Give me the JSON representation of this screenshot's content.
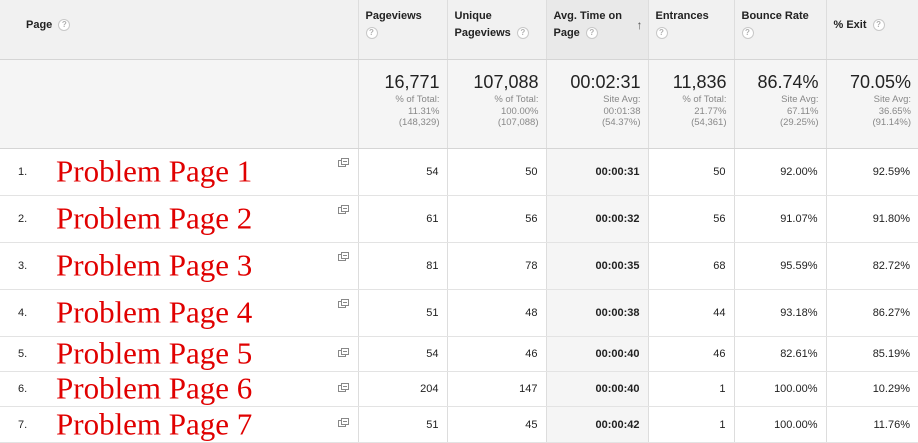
{
  "columns": {
    "page": "Page",
    "pageviews": "Pageviews",
    "unique_line1": "Unique",
    "unique_line2": "Pageviews",
    "avgtime_line1": "Avg. Time on",
    "avgtime_line2": "Page",
    "entrances": "Entrances",
    "bounce": "Bounce Rate",
    "exit": "% Exit",
    "help_glyph": "?",
    "sort_glyph": "↑"
  },
  "summary": {
    "pageviews": {
      "value": "16,771",
      "line1": "% of Total:",
      "line2": "11.31%",
      "line3": "(148,329)"
    },
    "unique": {
      "value": "107,088",
      "line1": "% of Total:",
      "line2": "100.00%",
      "line3": "(107,088)"
    },
    "avgtime": {
      "value": "00:02:31",
      "line1": "Site Avg:",
      "line2": "00:01:38",
      "line3": "(54.37%)"
    },
    "entrances": {
      "value": "11,836",
      "line1": "% of Total:",
      "line2": "21.77%",
      "line3": "(54,361)"
    },
    "bounce": {
      "value": "86.74%",
      "line1": "Site Avg:",
      "line2": "67.11%",
      "line3": "(29.25%)"
    },
    "exit": {
      "value": "70.05%",
      "line1": "Site Avg:",
      "line2": "36.65%",
      "line3": "(91.14%)"
    }
  },
  "rows": [
    {
      "index": "1.",
      "page": "Problem Page 1",
      "pageviews": "54",
      "unique": "50",
      "avgtime": "00:00:31",
      "entrances": "50",
      "bounce": "92.00%",
      "exit": "92.59%"
    },
    {
      "index": "2.",
      "page": "Problem Page 2",
      "pageviews": "61",
      "unique": "56",
      "avgtime": "00:00:32",
      "entrances": "56",
      "bounce": "91.07%",
      "exit": "91.80%"
    },
    {
      "index": "3.",
      "page": "Problem Page 3",
      "pageviews": "81",
      "unique": "78",
      "avgtime": "00:00:35",
      "entrances": "68",
      "bounce": "95.59%",
      "exit": "82.72%"
    },
    {
      "index": "4.",
      "page": "Problem Page 4",
      "pageviews": "51",
      "unique": "48",
      "avgtime": "00:00:38",
      "entrances": "44",
      "bounce": "93.18%",
      "exit": "86.27%"
    },
    {
      "index": "5.",
      "page": "Problem Page 5",
      "pageviews": "54",
      "unique": "46",
      "avgtime": "00:00:40",
      "entrances": "46",
      "bounce": "82.61%",
      "exit": "85.19%"
    },
    {
      "index": "6.",
      "page": "Problem Page 6",
      "pageviews": "204",
      "unique": "147",
      "avgtime": "00:00:40",
      "entrances": "1",
      "bounce": "100.00%",
      "exit": "10.29%"
    },
    {
      "index": "7.",
      "page": "Problem Page 7",
      "pageviews": "51",
      "unique": "45",
      "avgtime": "00:00:42",
      "entrances": "1",
      "bounce": "100.00%",
      "exit": "11.76%"
    }
  ],
  "colors": {
    "page_name": "#e00000",
    "header_bg": "#f1f1f1",
    "summary_bg": "#f5f5f5",
    "border": "#dddddd"
  }
}
